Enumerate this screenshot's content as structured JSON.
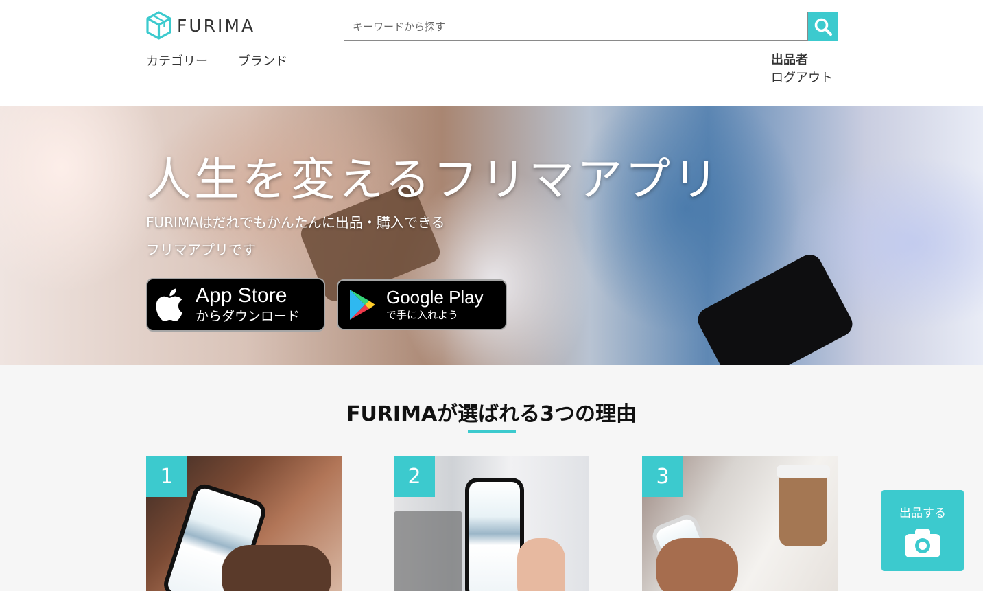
{
  "header": {
    "logo_text": "FURIMA",
    "search_placeholder": "キーワードから探す",
    "nav_left": [
      "カテゴリー",
      "ブランド"
    ],
    "nav_right": {
      "seller": "出品者",
      "logout": "ログアウト"
    }
  },
  "hero": {
    "title": "人生を変えるフリマアプリ",
    "subtitle_line1": "FURIMAはだれでもかんたんに出品・購入できる",
    "subtitle_line2": "フリマアプリです",
    "app_store": {
      "big": "App Store",
      "small": "からダウンロード"
    },
    "google_play": {
      "big": "Google Play",
      "small": "で手に入れよう"
    }
  },
  "reasons": {
    "title": "FURIMAが選ばれる3つの理由",
    "cards": [
      {
        "number": "1"
      },
      {
        "number": "2"
      },
      {
        "number": "3"
      }
    ]
  },
  "sell_button": {
    "label": "出品する"
  },
  "colors": {
    "accent": "#3ccace",
    "text": "#333333",
    "section_bg": "#f6f6f6"
  },
  "icons": [
    "furima-logo-icon",
    "search-icon",
    "apple-icon",
    "google-play-icon",
    "camera-icon"
  ]
}
